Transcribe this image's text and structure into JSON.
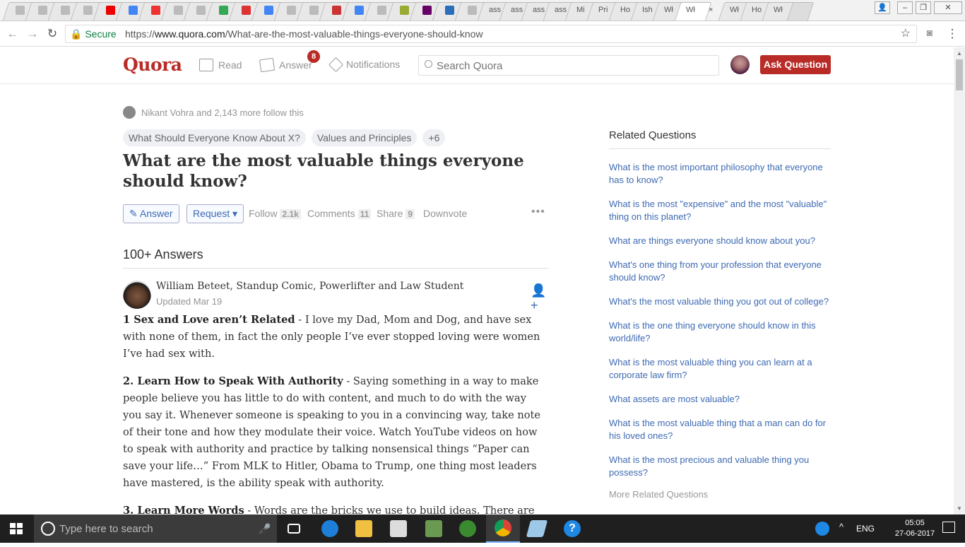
{
  "browser": {
    "tab_labels": [
      "ass",
      "ass",
      "ass",
      "ass",
      "Mi",
      "Pri",
      "Ho",
      "Ish",
      "Wł",
      "Wł",
      "Wł",
      "Ho",
      "Wł"
    ],
    "secure_label": "Secure",
    "url_scheme": "https://",
    "url_host": "www.quora.com",
    "url_path": "/What-are-the-most-valuable-things-everyone-should-know"
  },
  "header": {
    "logo": "Quora",
    "nav_read": "Read",
    "nav_answer": "Answer",
    "answer_badge": "8",
    "nav_notifications": "Notifications",
    "search_placeholder": "Search Quora",
    "ask_button": "Ask Question"
  },
  "question": {
    "followers_text": "Nikant Vohra and 2,143 more follow this",
    "topics": [
      "What Should Everyone Know About X?",
      "Values and Principles",
      "+6"
    ],
    "title": "What are the most valuable things everyone should know?",
    "actions": {
      "answer": "Answer",
      "request": "Request ▾",
      "follow": "Follow",
      "follow_count": "2.1k",
      "comments": "Comments",
      "comments_count": "11",
      "share": "Share",
      "share_count": "9",
      "downvote": "Downvote",
      "more": "•••"
    },
    "answers_count": "100+ Answers"
  },
  "answer": {
    "author_line": "William Beteet, Standup Comic, Powerlifter and Law Student",
    "date": "Updated Mar 19",
    "p1_bold": "1 Sex and Love aren’t Related",
    "p1_text": " - I love my Dad, Mom and Dog, and have sex with none of them, in fact the only people I’ve ever stopped loving were women I’ve had sex with.",
    "p2_bold": "2. Learn How to Speak With Authority",
    "p2_text": " - Saying something in a way to make people believe you has little to do with content, and much to do with the way you say it. Whenever someone is speaking to you in a convincing way, take note of their tone and how they modulate their voice. Watch YouTube videos on how to speak with authority and practice by talking nonsensical things “Paper can save your life…” From MLK to Hitler, Obama to Trump, one thing most leaders have mastered, is the ability speak with authority.",
    "p3_bold": "3. Learn More Words",
    "p3_text": " - Words are the bricks we use to build ideas. There are colors"
  },
  "sidebar": {
    "title": "Related Questions",
    "questions": [
      "What is the most important philosophy that everyone has to know?",
      "What is the most \"expensive\" and the most \"valuable\" thing on this planet?",
      "What are things everyone should know about you?",
      "What's one thing from your profession that everyone should know?",
      "What's the most valuable thing you got out of college?",
      "What is the one thing everyone should know in this world/life?",
      "What is the most valuable thing you can learn at a corporate law firm?",
      "What assets are most valuable?",
      "What is the most valuable thing that a man can do for his loved ones?",
      "What is the most precious and valuable thing you possess?"
    ],
    "more": "More Related Questions"
  },
  "taskbar": {
    "search_placeholder": "Type here to search",
    "language": "ENG",
    "time": "05:05",
    "date": "27-06-2017"
  },
  "colors": {
    "brand": "#b92b27",
    "link": "#3e6ab2"
  }
}
